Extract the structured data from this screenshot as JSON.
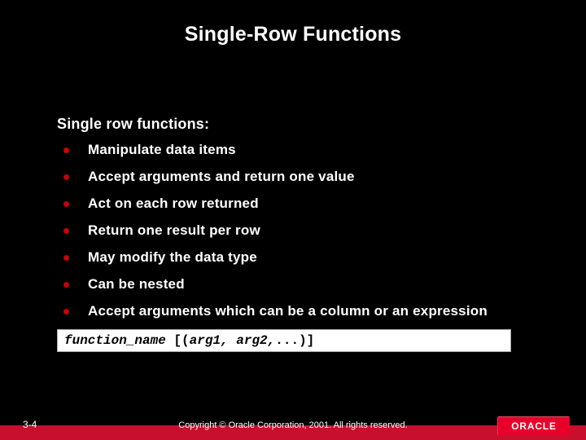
{
  "title": "Single-Row Functions",
  "intro": "Single row functions:",
  "bullets": [
    "Manipulate data items",
    "Accept arguments and return one value",
    "Act on each row returned",
    "Return one result per row",
    "May modify the data type",
    "Can be nested",
    "Accept arguments which can be a column or an expression"
  ],
  "code_fn": "function_name",
  "code_open": " [(",
  "code_args": "arg1, arg2,",
  "code_close": "...)]",
  "slidenum": "3-4",
  "copyright": "Copyright © Oracle Corporation, 2001. All rights reserved.",
  "logo": "ORACLE"
}
